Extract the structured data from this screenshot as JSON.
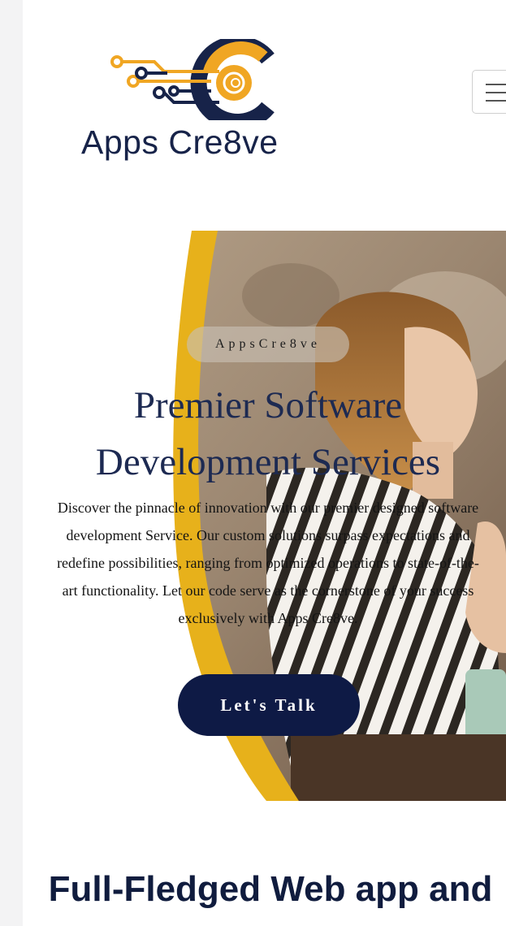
{
  "header": {
    "logo_text": "Apps Cre8ve",
    "logo_icon": "circuit-c-logo",
    "menu_icon": "hamburger-icon"
  },
  "hero": {
    "badge": "AppsCre8ve",
    "title": "Premier Software Development Services",
    "description": "Discover the pinnacle of innovation with our premier designed software development Service. Our custom solutions surpass expectations and redefine possibilities, ranging from optimized operations to state-of-the-art functionality. Let our code serve as the cornerstone of your success exclusively with Apps Cre8ve.",
    "cta_label": "Let's Talk"
  },
  "section": {
    "title": "Full-Fledged Web app and software"
  },
  "colors": {
    "brand_navy": "#0e1a45",
    "brand_orange": "#f0a623",
    "accent_yellow": "#e7b11b"
  }
}
